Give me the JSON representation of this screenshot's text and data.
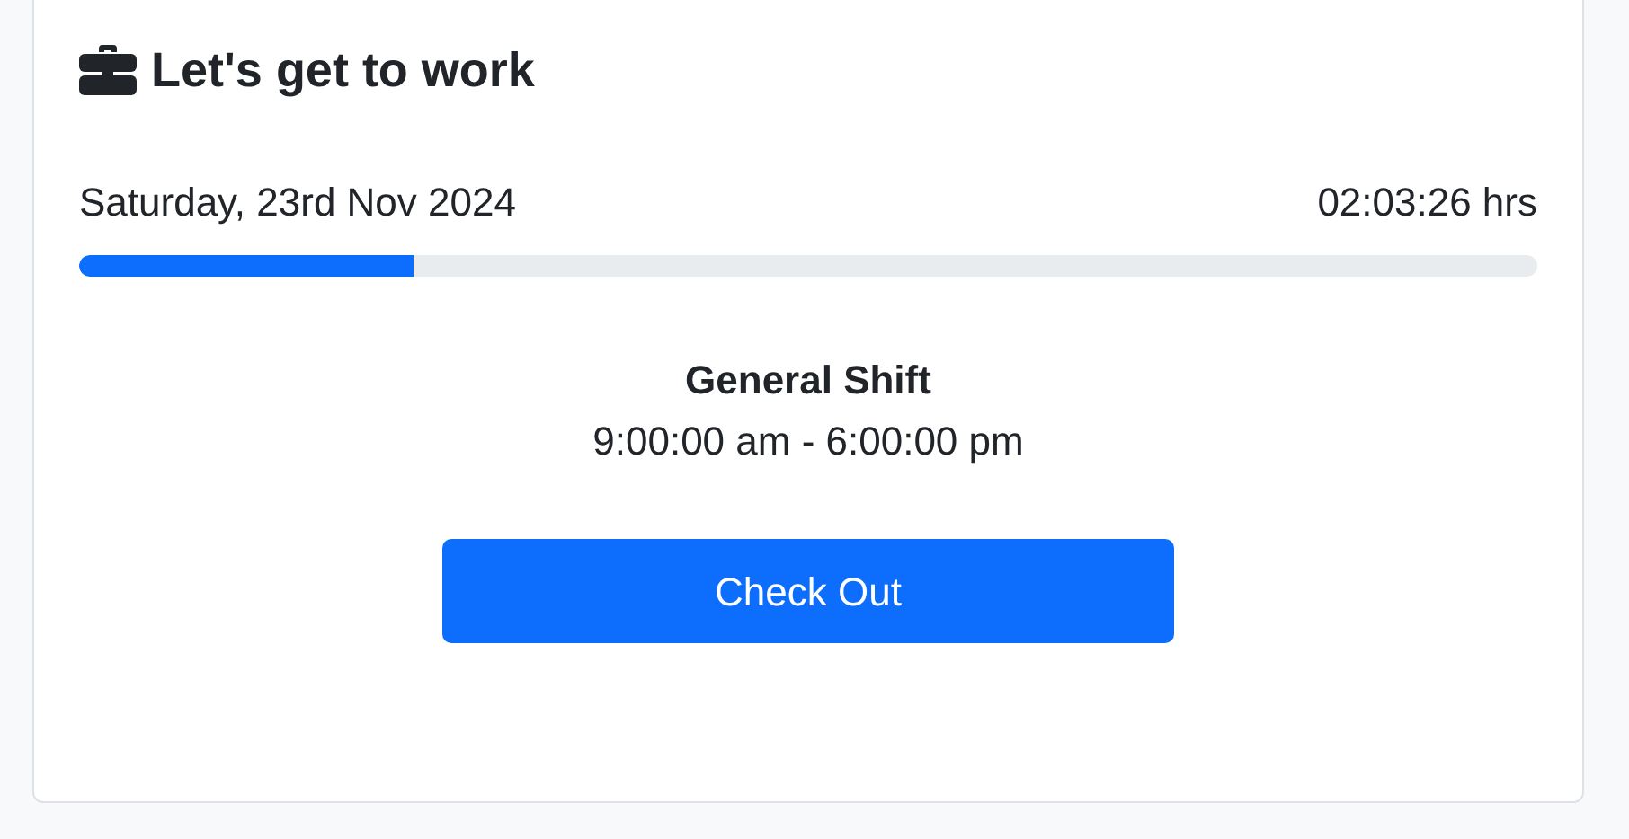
{
  "card": {
    "title": "Let's get to work",
    "date": "Saturday, 23rd Nov 2024",
    "elapsed": "02:03:26 hrs",
    "progress": {
      "level": 0.229
    },
    "shift": {
      "name": "General Shift",
      "hours": "9:00:00 am - 6:00:00 pm"
    },
    "button": "Check Out"
  }
}
